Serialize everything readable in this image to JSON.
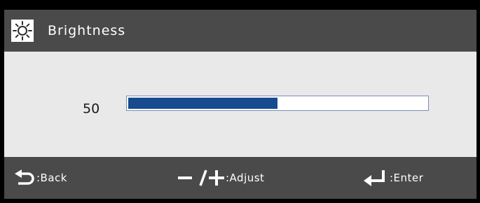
{
  "header": {
    "icon": "brightness-sun-icon",
    "title": "Brightness"
  },
  "brightness": {
    "value_text": "50",
    "level_percent": 50
  },
  "footer": {
    "back": {
      "icon": "back-arrow-icon",
      "label": ":Back"
    },
    "adjust": {
      "icon": "minus-plus-icon",
      "label": ":Adjust"
    },
    "enter": {
      "icon": "enter-return-icon",
      "label": ":Enter"
    }
  },
  "colors": {
    "panel_dark": "#4a4a4a",
    "panel_light": "#e9e9e9",
    "bar_fill": "#174a8e",
    "bar_border": "#7a8fb5"
  }
}
